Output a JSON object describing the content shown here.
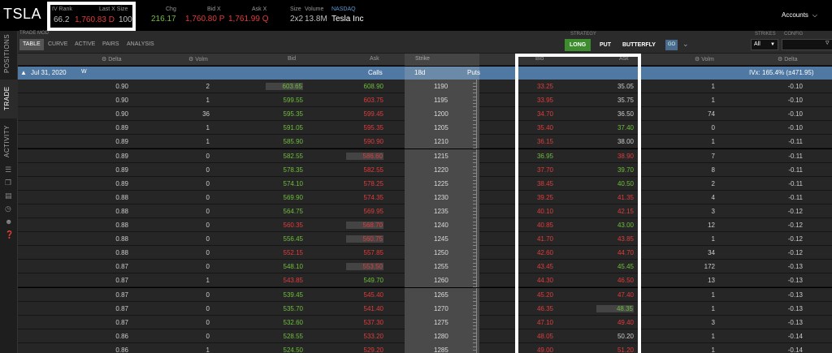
{
  "symbol": "TSLA",
  "header": {
    "iv_rank_label": "IV Rank",
    "iv_rank_value": "66.2",
    "last_label": "Last X Size",
    "last_value": "1,760.83 D",
    "last_size": "100",
    "chg_label": "Chg",
    "chg_value": "216.17",
    "bid_label": "Bid X",
    "bid_value": "1,760.80 P",
    "ask_label": "Ask X",
    "ask_value": "1,761.99 Q",
    "size_label": "Size",
    "size_value": "2x2",
    "volume_label": "Volume",
    "volume_value": "13.8M",
    "exchange": "NASDAQ",
    "company": "Tesla Inc",
    "accounts": "Accounts"
  },
  "toolbar": {
    "trade_mode_label": "TRADE MOD",
    "tabs": [
      "TABLE",
      "CURVE",
      "ACTIVE",
      "PAIRS",
      "ANALYSIS"
    ],
    "strategy_label": "STRATEGY",
    "strategy_long": "LONG",
    "strategy_put": "PUT",
    "strategy_butterfly": "BUTTERFLY",
    "go": "GO",
    "strikes_label": "STRIKES",
    "strikes_value": "All",
    "config_label": "CONFIG"
  },
  "sidebar": {
    "tabs": [
      "POSITIONS",
      "TRADE",
      "ACTIVITY"
    ]
  },
  "columns": {
    "delta": "Delta",
    "volm": "Volm",
    "bid": "Bid",
    "ask": "Ask",
    "strike": "Strike",
    "put_bid": "Bid",
    "put_ask": "Ask",
    "put_volm": "Volm",
    "put_delta": "Delta"
  },
  "expiration": {
    "date": "Jul 31, 2020",
    "weekly": "W",
    "calls": "Calls",
    "dte": "18d",
    "puts": "Puts",
    "ivx": "IVx: 165.4% (±471.95)"
  },
  "rows": [
    {
      "c_delta": "0.90",
      "c_volm": "2",
      "c_bid": "603.65",
      "c_ask": "608.90",
      "strike": "1190",
      "p_bid": "33.25",
      "p_ask": "35.05",
      "p_volm": "1",
      "p_delta": "-0.10",
      "cb": "g",
      "ca": "g",
      "pb": "r",
      "pa": "n",
      "cbh": true
    },
    {
      "c_delta": "0.90",
      "c_volm": "1",
      "c_bid": "599.55",
      "c_ask": "603.75",
      "strike": "1195",
      "p_bid": "33.95",
      "p_ask": "35.75",
      "p_volm": "1",
      "p_delta": "-0.10",
      "cb": "g",
      "ca": "r",
      "pb": "r",
      "pa": "n"
    },
    {
      "c_delta": "0.90",
      "c_volm": "36",
      "c_bid": "595.35",
      "c_ask": "599.45",
      "strike": "1200",
      "p_bid": "34.70",
      "p_ask": "36.50",
      "p_volm": "74",
      "p_delta": "-0.10",
      "cb": "g",
      "ca": "r",
      "pb": "r",
      "pa": "n"
    },
    {
      "c_delta": "0.89",
      "c_volm": "1",
      "c_bid": "591.05",
      "c_ask": "595.35",
      "strike": "1205",
      "p_bid": "35.40",
      "p_ask": "37.40",
      "p_volm": "0",
      "p_delta": "-0.10",
      "cb": "g",
      "ca": "r",
      "pb": "r",
      "pa": "g"
    },
    {
      "c_delta": "0.89",
      "c_volm": "1",
      "c_bid": "585.90",
      "c_ask": "590.90",
      "strike": "1210",
      "p_bid": "36.15",
      "p_ask": "38.00",
      "p_volm": "1",
      "p_delta": "-0.11",
      "cb": "g",
      "ca": "r",
      "pb": "r",
      "pa": "n"
    },
    {
      "c_delta": "0.89",
      "c_volm": "0",
      "c_bid": "582.55",
      "c_ask": "586.60",
      "strike": "1215",
      "p_bid": "36.95",
      "p_ask": "38.90",
      "p_volm": "7",
      "p_delta": "-0.11",
      "cb": "g",
      "ca": "r",
      "pb": "g",
      "pa": "r",
      "cah": true
    },
    {
      "c_delta": "0.89",
      "c_volm": "0",
      "c_bid": "578.35",
      "c_ask": "582.55",
      "strike": "1220",
      "p_bid": "37.70",
      "p_ask": "39.70",
      "p_volm": "8",
      "p_delta": "-0.11",
      "cb": "g",
      "ca": "r",
      "pb": "r",
      "pa": "g"
    },
    {
      "c_delta": "0.89",
      "c_volm": "0",
      "c_bid": "574.10",
      "c_ask": "578.25",
      "strike": "1225",
      "p_bid": "38.45",
      "p_ask": "40.50",
      "p_volm": "2",
      "p_delta": "-0.11",
      "cb": "g",
      "ca": "r",
      "pb": "r",
      "pa": "g"
    },
    {
      "c_delta": "0.88",
      "c_volm": "0",
      "c_bid": "569.90",
      "c_ask": "574.35",
      "strike": "1230",
      "p_bid": "39.25",
      "p_ask": "41.35",
      "p_volm": "4",
      "p_delta": "-0.11",
      "cb": "g",
      "ca": "r",
      "pb": "r",
      "pa": "r"
    },
    {
      "c_delta": "0.88",
      "c_volm": "0",
      "c_bid": "564.75",
      "c_ask": "569.95",
      "strike": "1235",
      "p_bid": "40.10",
      "p_ask": "42.15",
      "p_volm": "3",
      "p_delta": "-0.12",
      "cb": "g",
      "ca": "r",
      "pb": "r",
      "pa": "r"
    },
    {
      "c_delta": "0.88",
      "c_volm": "0",
      "c_bid": "560.35",
      "c_ask": "568.70",
      "strike": "1240",
      "p_bid": "40.85",
      "p_ask": "43.00",
      "p_volm": "12",
      "p_delta": "-0.12",
      "cb": "r",
      "ca": "r",
      "pb": "r",
      "pa": "g",
      "cah": true
    },
    {
      "c_delta": "0.88",
      "c_volm": "0",
      "c_bid": "556.45",
      "c_ask": "560.75",
      "strike": "1245",
      "p_bid": "41.70",
      "p_ask": "43.85",
      "p_volm": "1",
      "p_delta": "-0.12",
      "cb": "g",
      "ca": "r",
      "pb": "r",
      "pa": "r",
      "cah": true
    },
    {
      "c_delta": "0.88",
      "c_volm": "0",
      "c_bid": "552.15",
      "c_ask": "557.85",
      "strike": "1250",
      "p_bid": "42.60",
      "p_ask": "44.70",
      "p_volm": "34",
      "p_delta": "-0.12",
      "cb": "r",
      "ca": "r",
      "pb": "r",
      "pa": "r"
    },
    {
      "c_delta": "0.87",
      "c_volm": "0",
      "c_bid": "548.10",
      "c_ask": "553.50",
      "strike": "1255",
      "p_bid": "43.45",
      "p_ask": "45.45",
      "p_volm": "172",
      "p_delta": "-0.13",
      "cb": "g",
      "ca": "r",
      "pb": "r",
      "pa": "g",
      "cah": true
    },
    {
      "c_delta": "0.87",
      "c_volm": "1",
      "c_bid": "543.85",
      "c_ask": "549.70",
      "strike": "1260",
      "p_bid": "44.30",
      "p_ask": "46.50",
      "p_volm": "13",
      "p_delta": "-0.13",
      "cb": "r",
      "ca": "g",
      "pb": "r",
      "pa": "r"
    },
    {
      "c_delta": "0.87",
      "c_volm": "0",
      "c_bid": "539.45",
      "c_ask": "545.40",
      "strike": "1265",
      "p_bid": "45.20",
      "p_ask": "47.40",
      "p_volm": "1",
      "p_delta": "-0.13",
      "cb": "g",
      "ca": "r",
      "pb": "r",
      "pa": "r"
    },
    {
      "c_delta": "0.87",
      "c_volm": "0",
      "c_bid": "535.70",
      "c_ask": "541.40",
      "strike": "1270",
      "p_bid": "46.35",
      "p_ask": "48.35",
      "p_volm": "1",
      "p_delta": "-0.13",
      "cb": "g",
      "ca": "r",
      "pb": "r",
      "pa": "g",
      "pah": true
    },
    {
      "c_delta": "0.87",
      "c_volm": "0",
      "c_bid": "532.60",
      "c_ask": "537.30",
      "strike": "1275",
      "p_bid": "47.10",
      "p_ask": "49.40",
      "p_volm": "3",
      "p_delta": "-0.13",
      "cb": "g",
      "ca": "r",
      "pb": "r",
      "pa": "r"
    },
    {
      "c_delta": "0.86",
      "c_volm": "0",
      "c_bid": "528.55",
      "c_ask": "533.20",
      "strike": "1280",
      "p_bid": "48.05",
      "p_ask": "50.20",
      "p_volm": "1",
      "p_delta": "-0.14",
      "cb": "g",
      "ca": "r",
      "pb": "r",
      "pa": "n"
    },
    {
      "c_delta": "0.86",
      "c_volm": "1",
      "c_bid": "524.50",
      "c_ask": "529.20",
      "strike": "1285",
      "p_bid": "49.00",
      "p_ask": "51.20",
      "p_volm": "1",
      "p_delta": "-0.14",
      "cb": "g",
      "ca": "r",
      "pb": "r",
      "pa": "r"
    }
  ],
  "colors": {
    "up": "#6fbf3c",
    "down": "#e03c3c",
    "expiration_bar": "#4f79a3",
    "strategy_long": "#3d8c2e"
  }
}
